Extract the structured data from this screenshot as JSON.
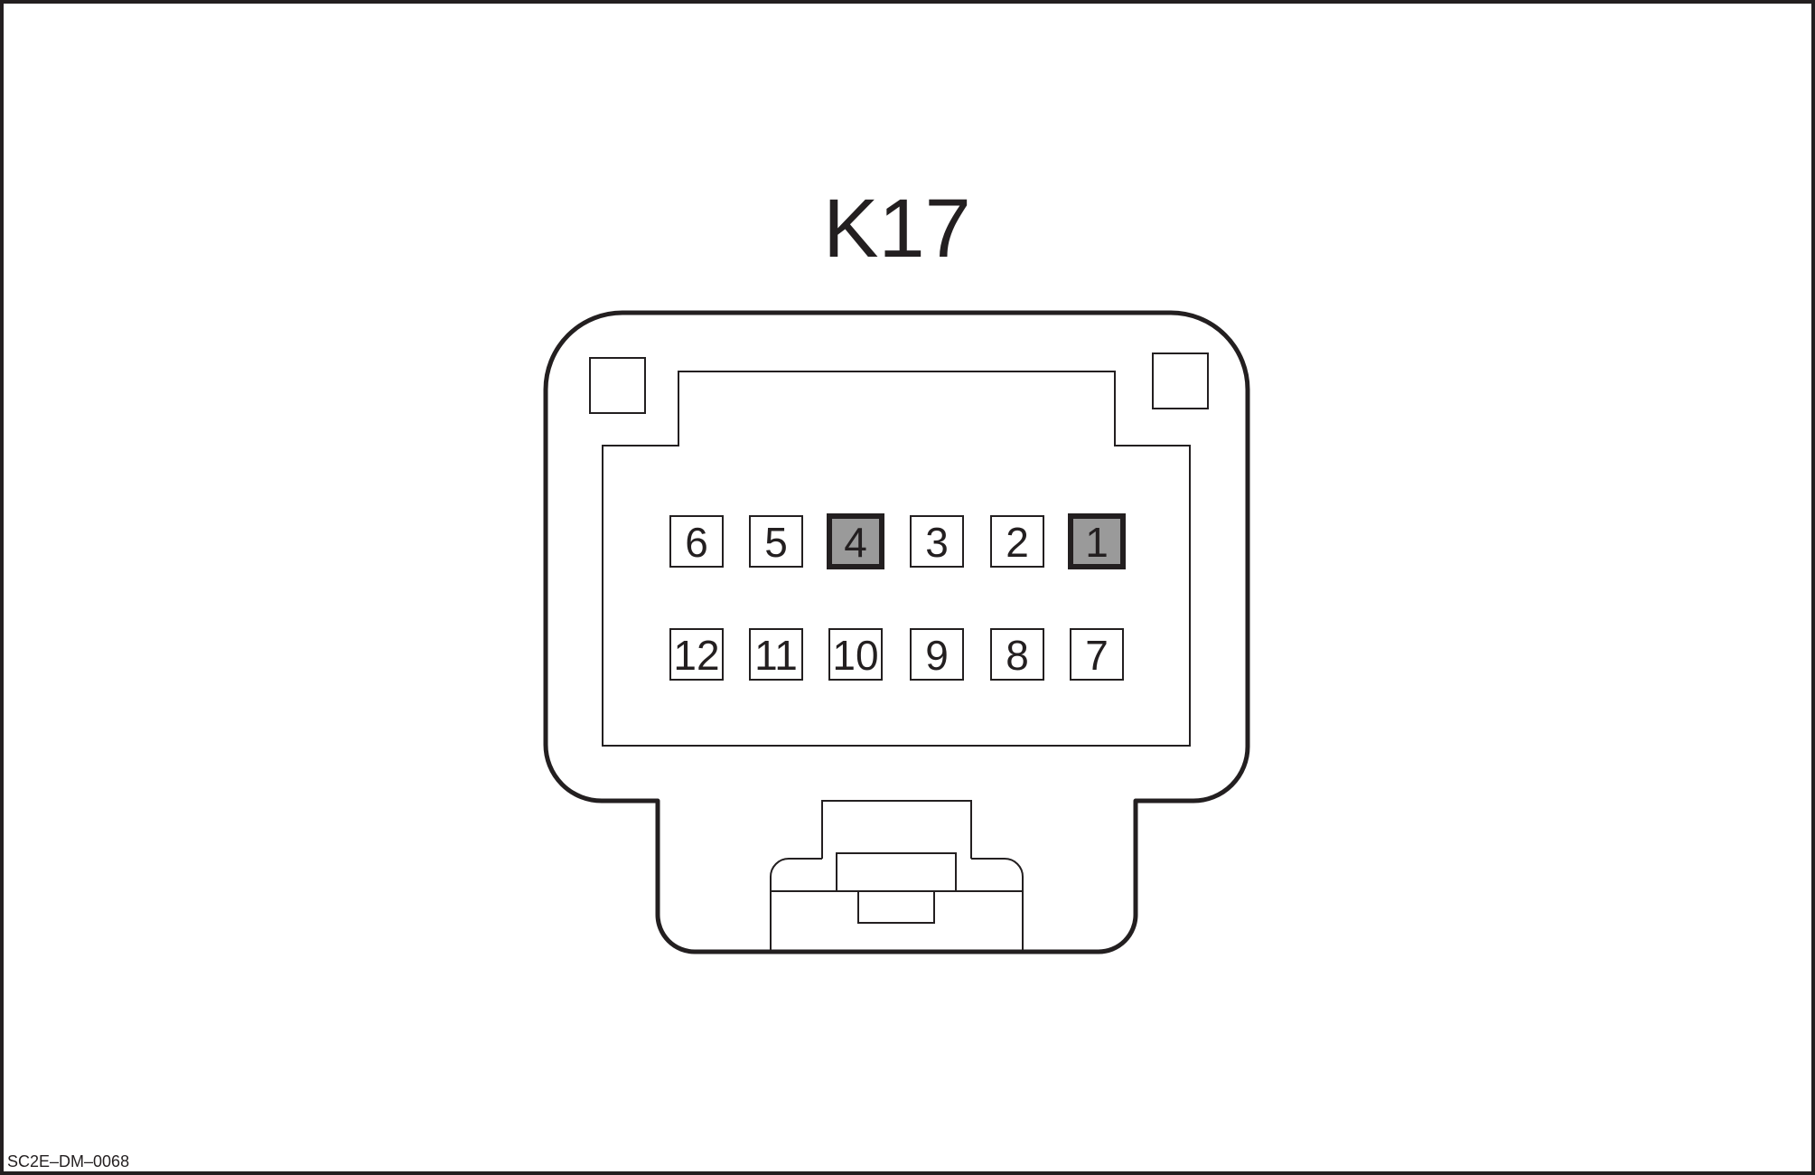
{
  "connector": {
    "title": "K17",
    "highlight_color": "#9a9a9a",
    "rows": [
      {
        "pins": [
          {
            "label": "6",
            "highlighted": false
          },
          {
            "label": "5",
            "highlighted": false
          },
          {
            "label": "4",
            "highlighted": true
          },
          {
            "label": "3",
            "highlighted": false
          },
          {
            "label": "2",
            "highlighted": false
          },
          {
            "label": "1",
            "highlighted": true
          }
        ]
      },
      {
        "pins": [
          {
            "label": "12",
            "highlighted": false
          },
          {
            "label": "11",
            "highlighted": false
          },
          {
            "label": "10",
            "highlighted": false
          },
          {
            "label": "9",
            "highlighted": false
          },
          {
            "label": "8",
            "highlighted": false
          },
          {
            "label": "7",
            "highlighted": false
          }
        ]
      }
    ]
  },
  "footer": {
    "code": "SC2E–DM–0068"
  }
}
